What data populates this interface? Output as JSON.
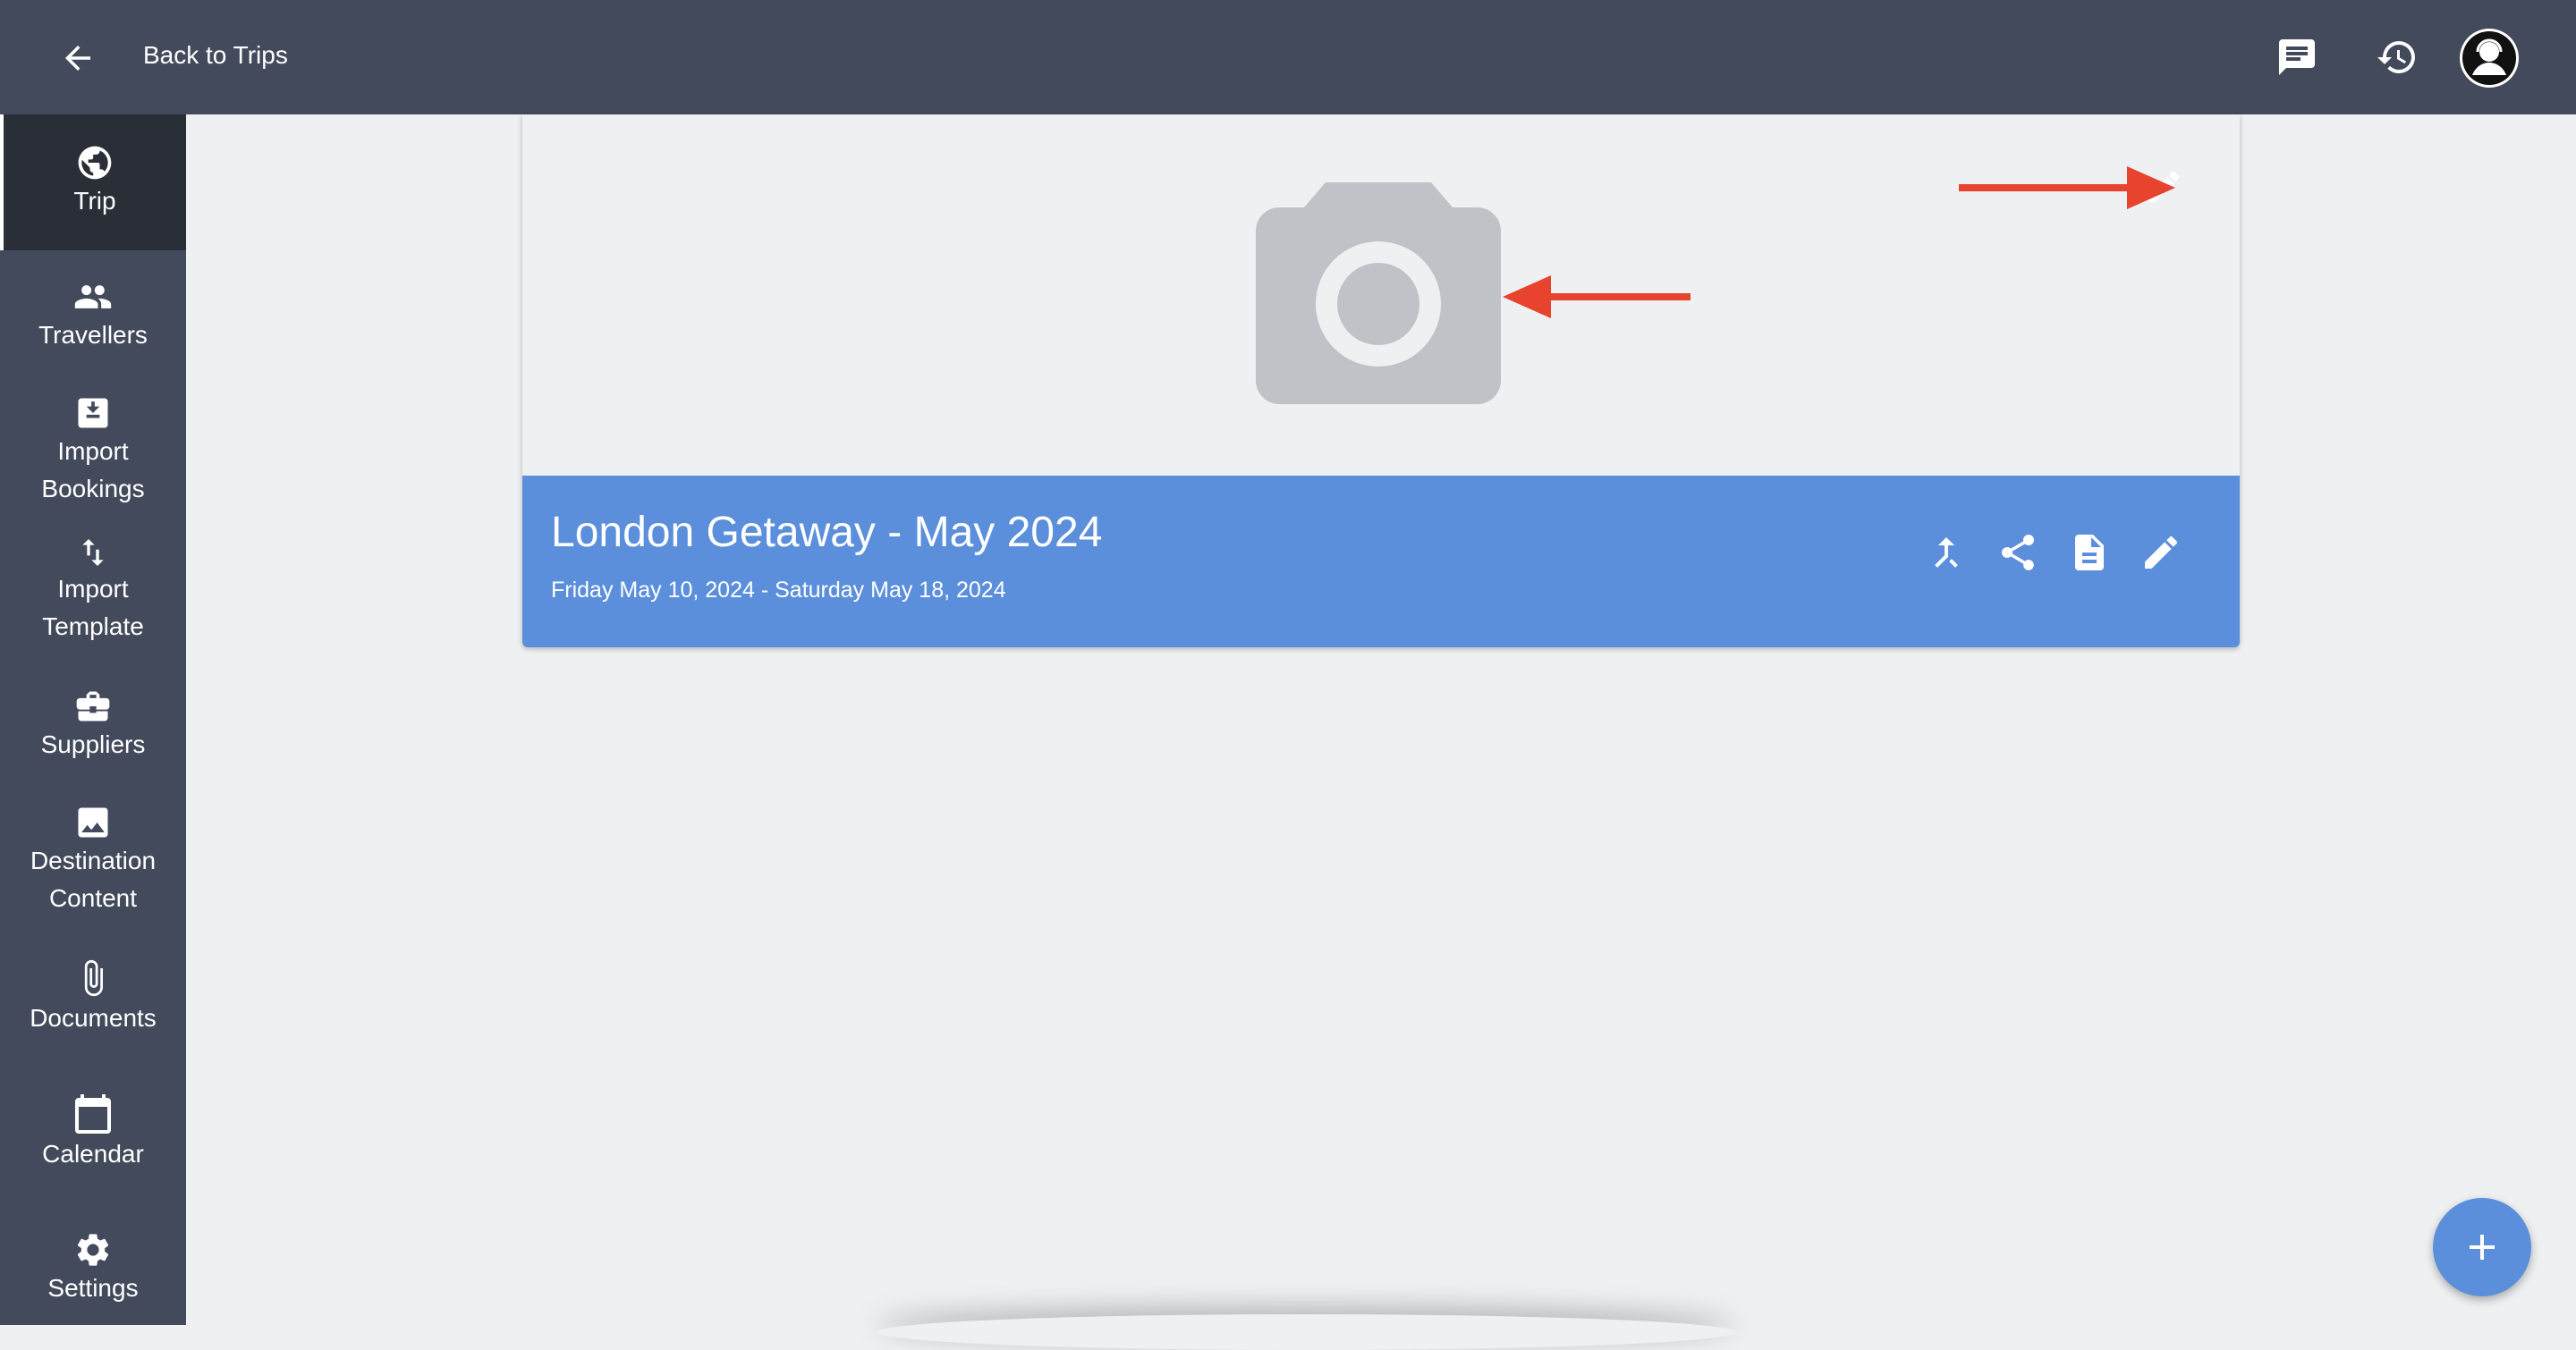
{
  "header": {
    "back_label": "Back to Trips",
    "back_icon": "arrow-left-icon",
    "chat_icon": "chat-icon",
    "history_icon": "history-icon",
    "avatar_icon": "user-avatar"
  },
  "sidebar": {
    "items": [
      {
        "label": "Trip",
        "icon": "globe-icon",
        "active": true
      },
      {
        "label": "Travellers",
        "icon": "people-icon"
      },
      {
        "label": "Import",
        "label2": "Bookings",
        "icon": "import-icon"
      },
      {
        "label": "Import",
        "label2": "Template",
        "icon": "swap-vertical-icon"
      },
      {
        "label": "Suppliers",
        "icon": "briefcase-icon"
      },
      {
        "label": "Destination",
        "label2": "Content",
        "icon": "image-icon"
      },
      {
        "label": "Documents",
        "icon": "paperclip-icon"
      },
      {
        "label": "Calendar",
        "icon": "calendar-icon"
      },
      {
        "label": "Settings",
        "icon": "gear-icon"
      }
    ]
  },
  "trip": {
    "title": "London Getaway - May 2024",
    "dates": "Friday May 10, 2024 - Saturday May 18, 2024"
  },
  "colors": {
    "topbar": "#434a5b",
    "sidebar_active": "#2a2e37",
    "accent": "#5b8fdc",
    "annotation_arrow": "#e8432e",
    "placeholder": "#bfc2c7"
  }
}
